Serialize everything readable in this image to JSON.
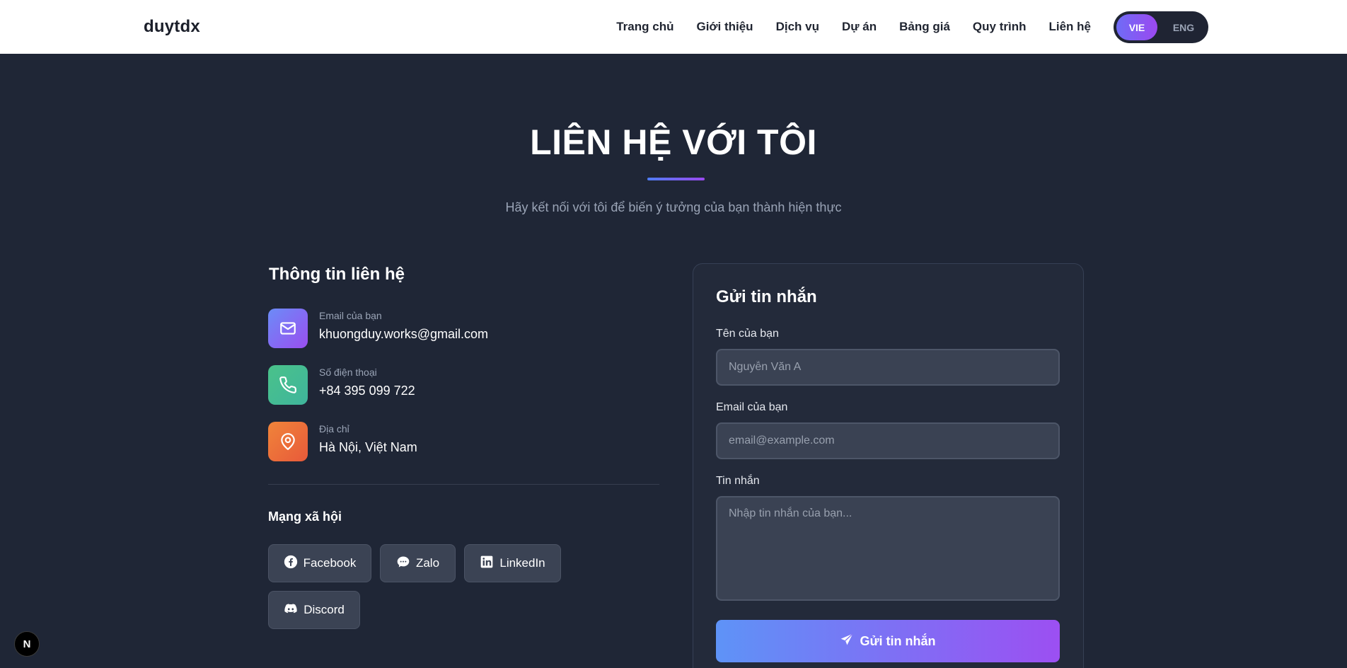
{
  "header": {
    "brand": "duytdx",
    "nav": [
      "Trang chủ",
      "Giới thiệu",
      "Dịch vụ",
      "Dự án",
      "Bảng giá",
      "Quy trình",
      "Liên hệ"
    ],
    "lang": {
      "active": "VIE",
      "inactive": "ENG"
    }
  },
  "hero": {
    "title": "LIÊN HỆ VỚI TÔI",
    "subtitle": "Hãy kết nối với tôi để biến ý tưởng của bạn thành hiện thực"
  },
  "contact_info": {
    "title": "Thông tin liên hệ",
    "items": [
      {
        "label": "Email của bạn",
        "value": "khuongduy.works@gmail.com",
        "icon": "mail-icon"
      },
      {
        "label": "Số điện thoại",
        "value": "+84 395 099 722",
        "icon": "phone-icon"
      },
      {
        "label": "Địa chỉ",
        "value": "Hà Nội, Việt Nam",
        "icon": "map-pin-icon"
      }
    ],
    "social_title": "Mạng xã hội",
    "social": [
      {
        "label": "Facebook",
        "icon": "facebook-icon"
      },
      {
        "label": "Zalo",
        "icon": "chat-bubble-icon"
      },
      {
        "label": "LinkedIn",
        "icon": "linkedin-icon"
      },
      {
        "label": "Discord",
        "icon": "discord-icon"
      }
    ]
  },
  "form": {
    "title": "Gửi tin nhắn",
    "name_label": "Tên của bạn",
    "name_placeholder": "Nguyễn Văn A",
    "name_value": "",
    "email_label": "Email của bạn",
    "email_placeholder": "email@example.com",
    "email_value": "",
    "message_label": "Tin nhắn",
    "message_placeholder": "Nhập tin nhắn của bạn...",
    "message_value": "",
    "submit_label": "Gửi tin nhắn"
  },
  "next_badge": "N",
  "colors": {
    "page_bg": "#1f2636",
    "accent_start": "#5e93f7",
    "accent_end": "#9c4ff2"
  }
}
